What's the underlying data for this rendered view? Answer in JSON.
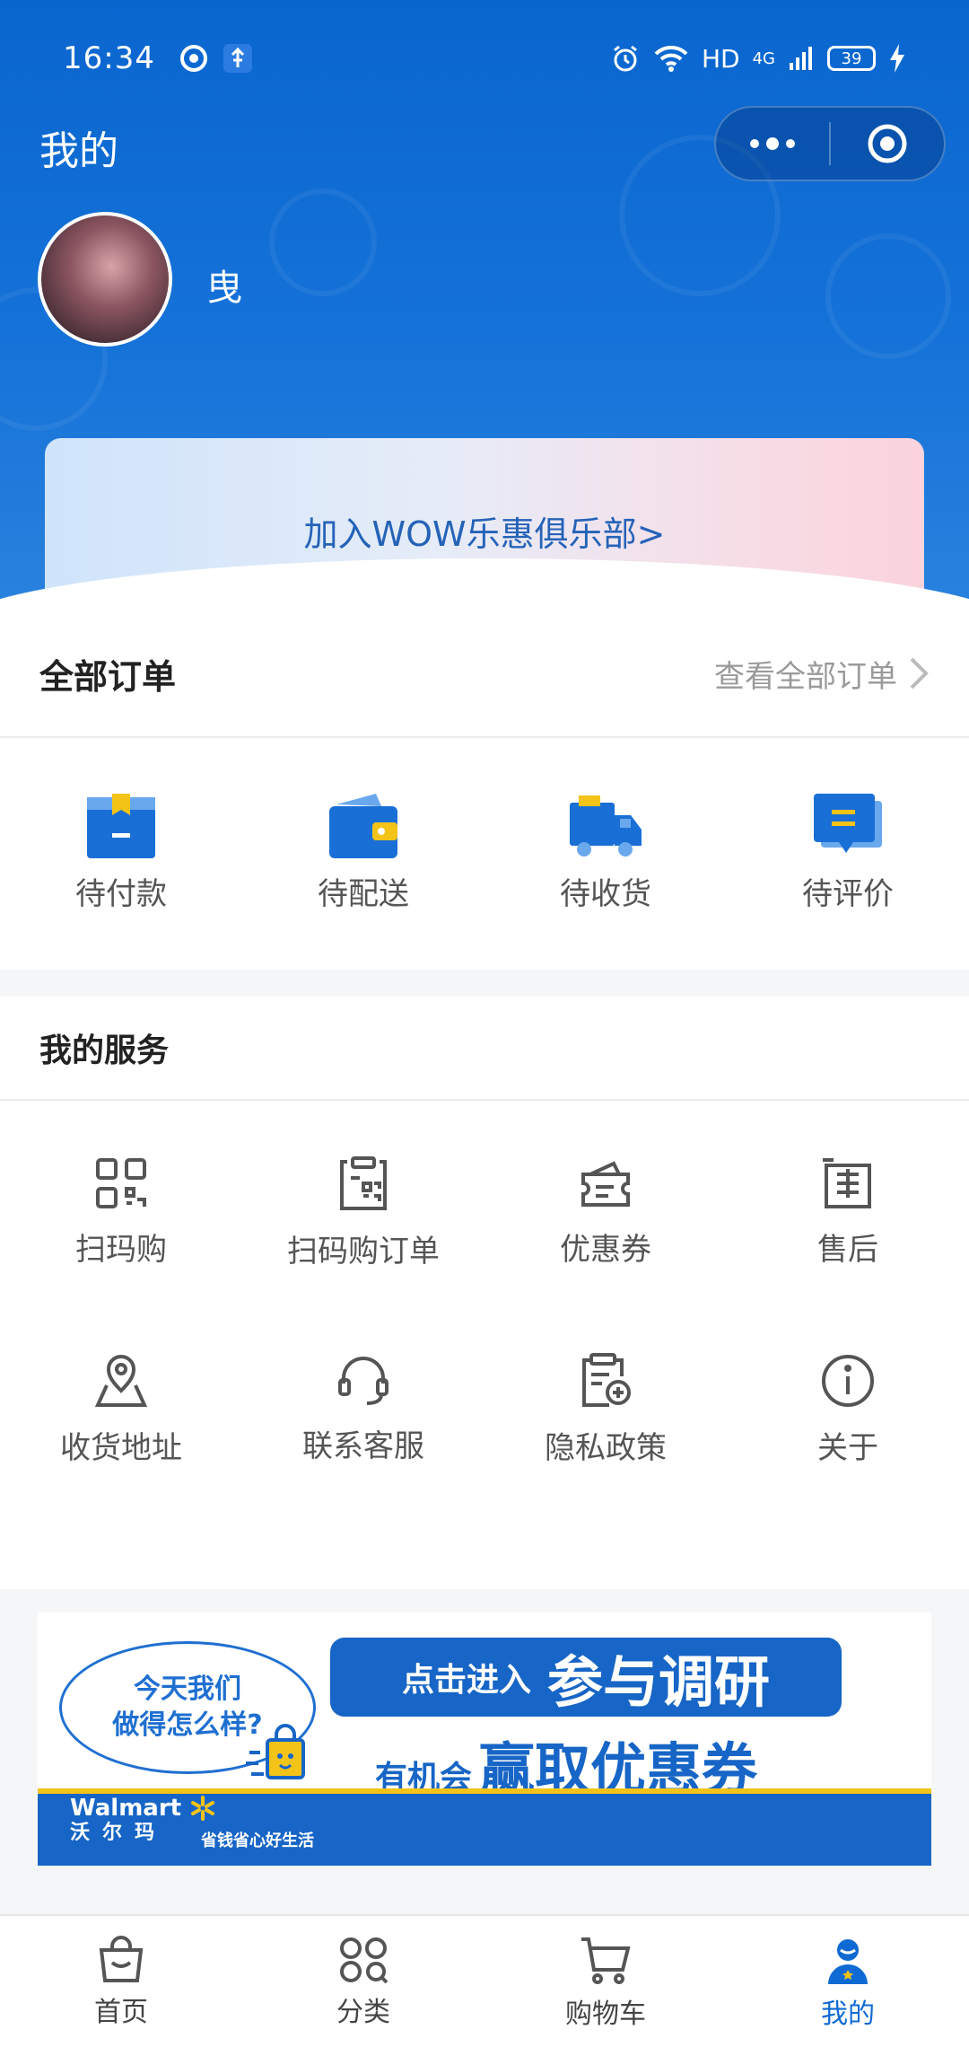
{
  "status_bar": {
    "time": "16:34",
    "network": "HD",
    "signal": "4G",
    "battery": "39"
  },
  "header": {
    "title": "我的",
    "username": "曳"
  },
  "wow_card": {
    "text": "加入WOW乐惠俱乐部>"
  },
  "orders": {
    "title": "全部订单",
    "view_all": "查看全部订单",
    "items": [
      {
        "label": "待付款",
        "icon": "pending-payment-icon"
      },
      {
        "label": "待配送",
        "icon": "wallet-icon"
      },
      {
        "label": "待收货",
        "icon": "delivery-truck-icon"
      },
      {
        "label": "待评价",
        "icon": "review-chat-icon"
      }
    ]
  },
  "services": {
    "title": "我的服务",
    "items": [
      {
        "label": "扫玛购",
        "icon": "qr-code-icon"
      },
      {
        "label": "扫码购订单",
        "icon": "qr-order-icon"
      },
      {
        "label": "优惠券",
        "icon": "coupon-icon"
      },
      {
        "label": "售后",
        "icon": "after-sales-icon"
      },
      {
        "label": "收货地址",
        "icon": "location-map-icon"
      },
      {
        "label": "联系客服",
        "icon": "headset-icon"
      },
      {
        "label": "隐私政策",
        "icon": "clipboard-icon"
      },
      {
        "label": "关于",
        "icon": "info-icon"
      }
    ]
  },
  "banner": {
    "bubble_line1": "今天我们",
    "bubble_line2": "做得怎么样?",
    "pill_small": "点击进入",
    "pill_big": "参与调研",
    "line2_small": "有机会",
    "line2_big": "赢取优惠券",
    "brand_en": "Walmart",
    "brand_cn": "沃尔玛",
    "slogan": "省钱省心好生活"
  },
  "tabbar": {
    "items": [
      {
        "label": "首页",
        "icon": "shopping-bag-icon"
      },
      {
        "label": "分类",
        "icon": "category-icon"
      },
      {
        "label": "购物车",
        "icon": "cart-icon"
      },
      {
        "label": "我的",
        "icon": "profile-icon",
        "active": true
      }
    ]
  },
  "colors": {
    "primary": "#0f6ad3",
    "banner_blue": "#1765c6",
    "accent_yellow": "#f3c318"
  }
}
